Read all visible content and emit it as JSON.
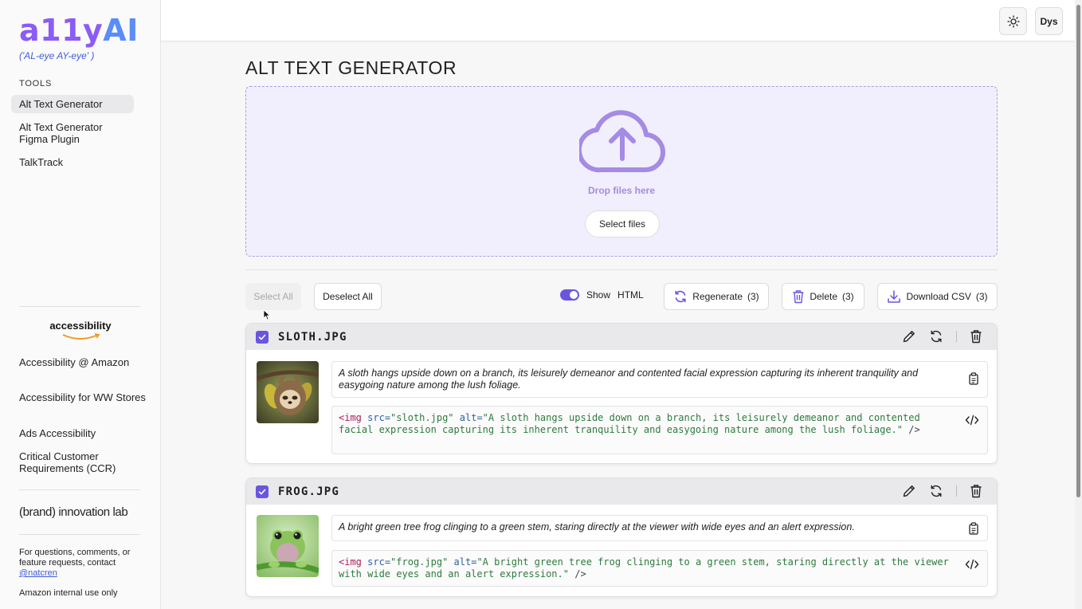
{
  "sidebar": {
    "logo_main": "a11y",
    "logo_ai": "AI",
    "pronunciation": "('AL-eye AY-eye' )",
    "tools_label": "TOOLS",
    "tools": [
      {
        "label": "Alt Text Generator"
      },
      {
        "label": "Alt Text Generator Figma Plugin"
      },
      {
        "label": "TalkTrack"
      }
    ],
    "accessibility_logo": "accessibility",
    "links": [
      {
        "label": "Accessibility @ Amazon"
      },
      {
        "label": "Accessibility for WW Stores"
      },
      {
        "label": "Ads Accessibility"
      },
      {
        "label": "Critical Customer Requirements (CCR)"
      }
    ],
    "brand_lab": "(brand) innovation lab",
    "contact_text": "For questions, comments, or feature requests, contact",
    "contact_link": "@natcren",
    "internal_note": "Amazon internal use only"
  },
  "topbar": {
    "dys_label": "Dys"
  },
  "main": {
    "title": "ALT TEXT GENERATOR",
    "dropzone": {
      "label": "Drop files here",
      "button": "Select files"
    },
    "toolbar": {
      "select_all": "Select All",
      "deselect_all": "Deselect All",
      "show_label": "Show",
      "html_label": "HTML",
      "show_html_on": true,
      "regenerate": "Regenerate",
      "regenerate_count": "(3)",
      "delete": "Delete",
      "delete_count": "(3)",
      "download_csv": "Download CSV",
      "download_count": "(3)"
    },
    "images": [
      {
        "filename": "SLOTH.JPG",
        "checked": true,
        "alt": "A sloth hangs upside down on a branch, its leisurely demeanor and contented facial expression capturing its inherent tranquility and easygoing nature among the lush foliage.",
        "code_tag": "<img",
        "code_src_attr": "src=",
        "code_src": "\"sloth.jpg\"",
        "code_alt_attr": "alt=",
        "code_alt": "\"A sloth hangs upside down on a branch, its leisurely demeanor and contented facial expression capturing its inherent tranquility and easygoing nature among the lush foliage.\"",
        "code_end": "/>"
      },
      {
        "filename": "FROG.JPG",
        "checked": true,
        "alt": "A bright green tree frog clinging to a green stem, staring directly at the viewer with wide eyes and an alert expression.",
        "code_tag": "<img",
        "code_src_attr": "src=",
        "code_src": "\"frog.jpg\"",
        "code_alt_attr": "alt=",
        "code_alt": "\"A bright green tree frog clinging to a green stem, staring directly at the viewer with wide eyes and an alert expression.\"",
        "code_end": "/>"
      }
    ]
  },
  "colors": {
    "accent": "#6a55e0",
    "logo_purple": "#8b5cf6",
    "drop_bg": "#f1effd",
    "drop_text": "#a48be3"
  },
  "icons": [
    "sun-icon",
    "cloud-upload-icon",
    "refresh-icon",
    "trash-icon",
    "download-icon",
    "pencil-icon",
    "copy-icon",
    "code-icon",
    "check-icon"
  ]
}
